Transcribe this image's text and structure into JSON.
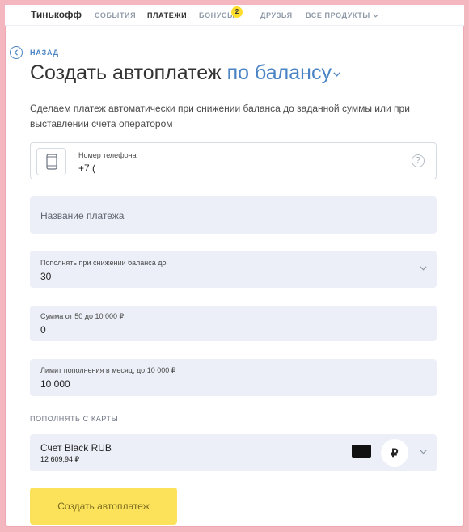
{
  "header": {
    "logo": "Тинькофф",
    "nav": [
      {
        "label": "СОБЫТИЯ"
      },
      {
        "label": "ПЛАТЕЖИ"
      },
      {
        "label": "БОНУСЫ"
      },
      {
        "label": "ДРУЗЬЯ"
      },
      {
        "label": "ВСЕ ПРОДУКТЫ"
      }
    ],
    "bonus_count": "2",
    "active_nav": "ПЛАТЕЖИ"
  },
  "back_label": "НАЗАД",
  "title": {
    "main": "Создать автоплатеж",
    "accent": "по балансу"
  },
  "description": "Сделаем платеж автоматически при снижении баланса до заданной суммы или при выставлении счета оператором",
  "phone_field": {
    "label": "Номер телефона",
    "value": "+7 ("
  },
  "payment_name_field": {
    "placeholder": "Название платежа"
  },
  "threshold_field": {
    "label": "Пополнять при снижении баланса до",
    "value": "30"
  },
  "amount_field": {
    "label": "Сумма от 50 до 10 000 ₽",
    "value": "0"
  },
  "limit_field": {
    "label": "Лимит пополнения в месяц, до 10 000 ₽",
    "value": "10 000"
  },
  "card_section_label": "ПОПОЛНЯТЬ С КАРТЫ",
  "card_select": {
    "name": "Счет Black RUB",
    "balance": "12 609,94 ₽",
    "currency_symbol": "₽"
  },
  "submit_label": "Создать автоплатеж",
  "colors": {
    "accent": "#4b84c4",
    "submit": "#fbe25a",
    "field_bg": "#eceff7",
    "badge": "#ffdd2d",
    "border": "#f4b7bf"
  },
  "icons": {
    "back": "chevron-left-icon",
    "phone": "phone-icon",
    "help": "question-icon",
    "dropdown": "chevron-down-icon"
  }
}
